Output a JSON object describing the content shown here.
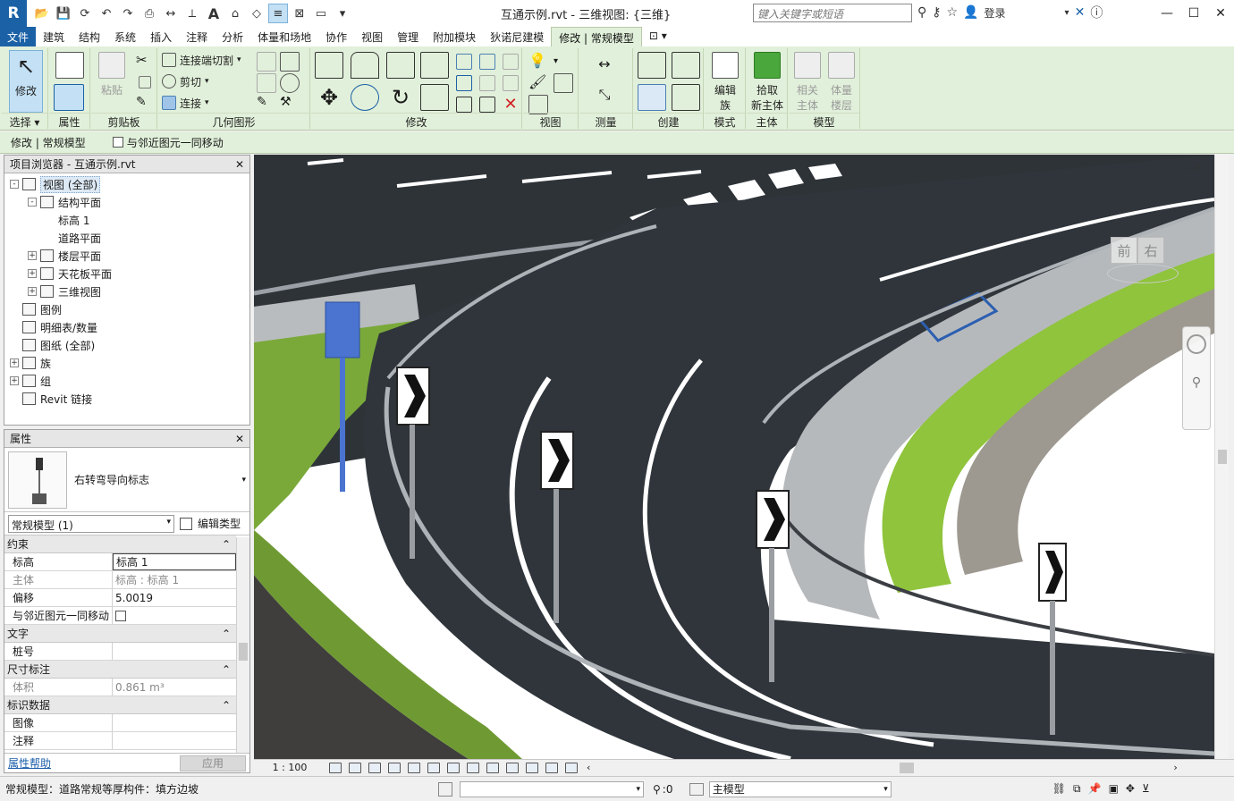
{
  "app": {
    "logo": "R",
    "title": "互通示例.rvt - 三维视图: {三维}",
    "search_placeholder": "键入关键字或短语",
    "login": "登录",
    "accent": "#1b61a6",
    "ribbon_bg": "#e1f0da"
  },
  "tabs": [
    "文件",
    "建筑",
    "结构",
    "系统",
    "插入",
    "注释",
    "分析",
    "体量和场地",
    "协作",
    "视图",
    "管理",
    "附加模块",
    "狄诺尼建模",
    "修改 | 常规模型"
  ],
  "active_tab": "修改 | 常规模型",
  "ribbon": {
    "select": {
      "modify": "修改",
      "label": "选择"
    },
    "properties": {
      "label": "属性"
    },
    "clipboard": {
      "paste": "粘贴",
      "label": "剪贴板"
    },
    "geometry": {
      "join_cut": "连接端切割",
      "cut": "剪切",
      "join": "连接",
      "label": "几何图形"
    },
    "modify": {
      "label": "修改"
    },
    "view": {
      "label": "视图"
    },
    "measure": {
      "label": "测量"
    },
    "create": {
      "label": "创建"
    },
    "mode": {
      "edit_family_1": "编辑",
      "edit_family_2": "族",
      "label": "模式"
    },
    "host": {
      "pick_1": "拾取",
      "pick_2": "新主体",
      "label": "主体"
    },
    "model": {
      "related_1": "相关",
      "related_2": "主体",
      "mass_1": "体量",
      "mass_2": "楼层",
      "label": "模型"
    }
  },
  "options_bar": {
    "context": "修改 | 常规模型",
    "move_with_nearby": "与邻近图元一同移动"
  },
  "browser": {
    "title": "项目浏览器 - 互通示例.rvt",
    "items": [
      {
        "label": "视图 (全部)",
        "level": 0,
        "expander": "-",
        "selected": true
      },
      {
        "label": "结构平面",
        "level": 1,
        "expander": "-"
      },
      {
        "label": "标高 1",
        "level": 2,
        "expander": ""
      },
      {
        "label": "道路平面",
        "level": 2,
        "expander": ""
      },
      {
        "label": "楼层平面",
        "level": 1,
        "expander": "+"
      },
      {
        "label": "天花板平面",
        "level": 1,
        "expander": "+"
      },
      {
        "label": "三维视图",
        "level": 1,
        "expander": "+"
      },
      {
        "label": "图例",
        "level": 0,
        "expander": ""
      },
      {
        "label": "明细表/数量",
        "level": 0,
        "expander": ""
      },
      {
        "label": "图纸 (全部)",
        "level": 0,
        "expander": ""
      },
      {
        "label": "族",
        "level": 0,
        "expander": "+"
      },
      {
        "label": "组",
        "level": 0,
        "expander": "+"
      },
      {
        "label": "Revit 链接",
        "level": 0,
        "expander": ""
      }
    ]
  },
  "properties": {
    "title": "属性",
    "type_name": "右转弯导向标志",
    "instance_filter": "常规模型 (1)",
    "edit_type": "编辑类型",
    "sections": [
      {
        "name": "约束",
        "rows": [
          {
            "key": "标高",
            "value": "标高 1",
            "dim": false
          },
          {
            "key": "主体",
            "value": "标高 : 标高 1",
            "dim": true
          },
          {
            "key": "偏移",
            "value": "5.0019",
            "dim": false
          },
          {
            "key": "与邻近图元一同移动",
            "value": "",
            "dim": false
          }
        ]
      },
      {
        "name": "文字",
        "rows": [
          {
            "key": "桩号",
            "value": "",
            "dim": false
          }
        ]
      },
      {
        "name": "尺寸标注",
        "rows": [
          {
            "key": "体积",
            "value": "0.861 m³",
            "dim": true
          }
        ]
      },
      {
        "name": "标识数据",
        "rows": [
          {
            "key": "图像",
            "value": "",
            "dim": false
          },
          {
            "key": "注释",
            "value": "",
            "dim": false
          }
        ]
      }
    ],
    "help": "属性帮助",
    "apply": "应用"
  },
  "viewcube": {
    "front": "前",
    "right": "右"
  },
  "view_bar": {
    "scale": "1 : 100"
  },
  "status": {
    "message": "常规模型：道路常规等厚构件：填方边坡",
    "select_count": ":0",
    "workset": "主模型"
  }
}
